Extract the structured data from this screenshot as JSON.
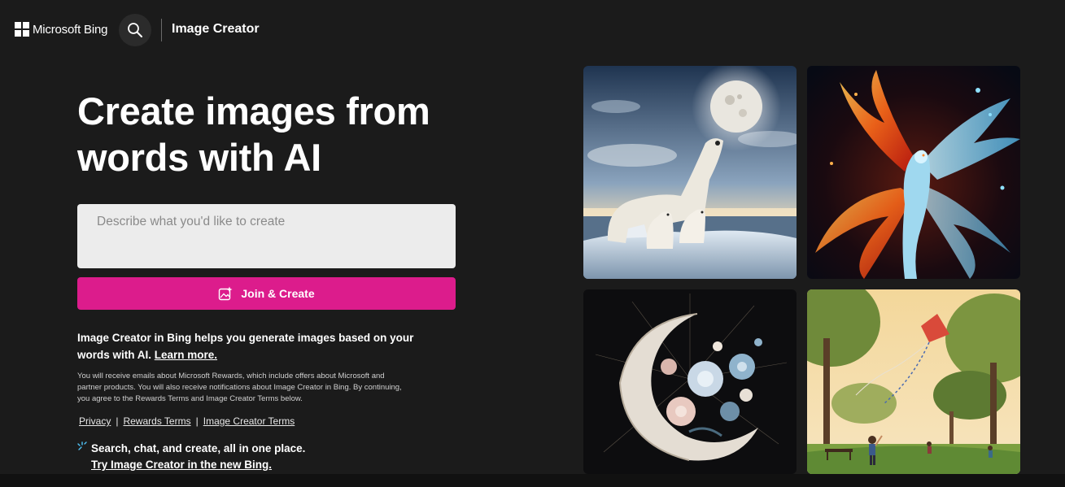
{
  "header": {
    "brand": "Microsoft Bing",
    "app_title": "Image Creator",
    "search_icon": "search-icon",
    "logo_icon": "microsoft-logo-icon"
  },
  "hero": {
    "title": "Create images from words with AI",
    "prompt_placeholder": "Describe what you'd like to create",
    "prompt_value": "",
    "create_button": "Join & Create",
    "create_icon": "image-sparkle-icon",
    "accent_color": "#dc1c8c"
  },
  "info": {
    "description": "Image Creator in Bing helps you generate images based on your words with AI.",
    "learn_more": "Learn more.",
    "fine_print": "You will receive emails about Microsoft Rewards, which include offers about Microsoft and partner products. You will also receive notifications about Image Creator in Bing. By continuing, you agree to the Rewards Terms and Image Creator Terms below."
  },
  "links": {
    "privacy": "Privacy",
    "rewards_terms": "Rewards Terms",
    "image_creator_terms": "Image Creator Terms",
    "separator": "|"
  },
  "promo": {
    "text": "Search, chat, and create, all in one place.",
    "link": "Try Image Creator in the new Bing.",
    "icon": "sparkle-icon"
  },
  "gallery": {
    "images": [
      {
        "subject": "polar-bears-moon"
      },
      {
        "subject": "fire-ice-phoenix"
      },
      {
        "subject": "crescent-moon-flowers"
      },
      {
        "subject": "park-kite-children"
      }
    ]
  }
}
